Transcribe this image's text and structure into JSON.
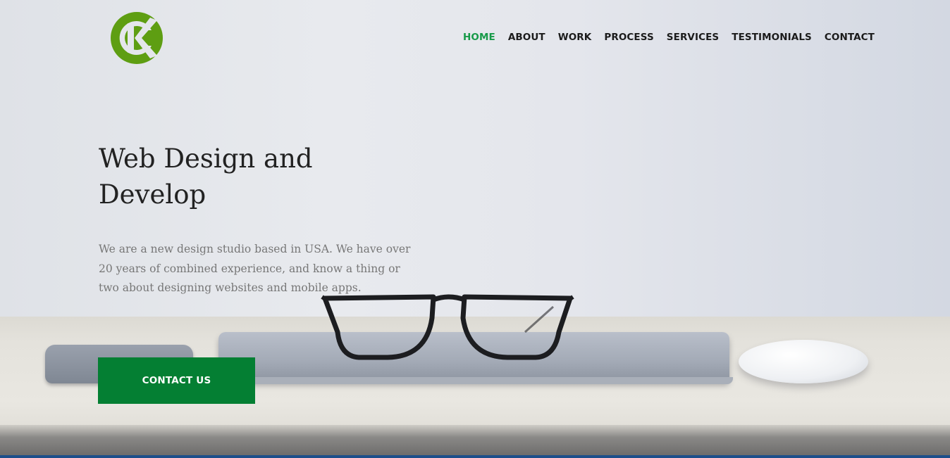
{
  "nav": {
    "items": [
      {
        "label": "HOME",
        "active": true
      },
      {
        "label": "ABOUT",
        "active": false
      },
      {
        "label": "WORK",
        "active": false
      },
      {
        "label": "PROCESS",
        "active": false
      },
      {
        "label": "SERVICES",
        "active": false
      },
      {
        "label": "TESTIMONIALS",
        "active": false
      },
      {
        "label": "CONTACT",
        "active": false
      }
    ]
  },
  "hero": {
    "headline": "Web Design and Develop",
    "intro": "We are a new design studio based in USA. We have over 20 years of combined experience, and know a thing or two about designing websites and mobile apps.",
    "cta_label": "CONTACT US"
  },
  "colors": {
    "accent": "#179a48",
    "cta_background": "#047f33",
    "logo_green": "#5e9e12"
  }
}
